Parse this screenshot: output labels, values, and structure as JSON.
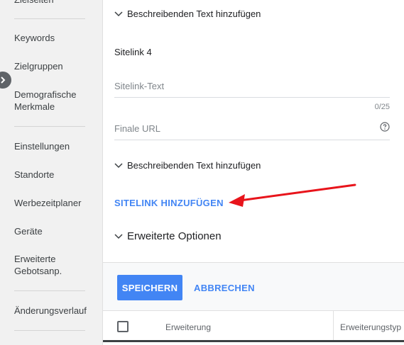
{
  "sidebar": {
    "items": [
      {
        "label": "Zielseiten"
      },
      {
        "label": "Keywords"
      },
      {
        "label": "Zielgruppen"
      },
      {
        "label": "Demografische Merkmale"
      },
      {
        "label": "Einstellungen"
      },
      {
        "label": "Standorte"
      },
      {
        "label": "Werbezeitplaner"
      },
      {
        "label": "Geräte"
      },
      {
        "label": "Erweiterte Gebotsanp."
      },
      {
        "label": "Änderungsverlauf"
      }
    ]
  },
  "form": {
    "expander_top": "Beschreibenden Text hinzufügen",
    "section_title": "Sitelink 4",
    "sitelink_text_placeholder": "Sitelink-Text",
    "sitelink_text_counter": "0/25",
    "final_url_placeholder": "Finale URL",
    "expander_bottom": "Beschreibenden Text hinzufügen",
    "add_sitelink_label": "SITELINK HINZUFÜGEN",
    "advanced_options_label": "Erweiterte Optionen"
  },
  "footer": {
    "save_label": "SPEICHERN",
    "cancel_label": "ABBRECHEN"
  },
  "table": {
    "columns": [
      "Erweiterung",
      "Erweiterungstyp"
    ]
  },
  "colors": {
    "accent": "#4285f4",
    "annotation": "#e8141b"
  }
}
